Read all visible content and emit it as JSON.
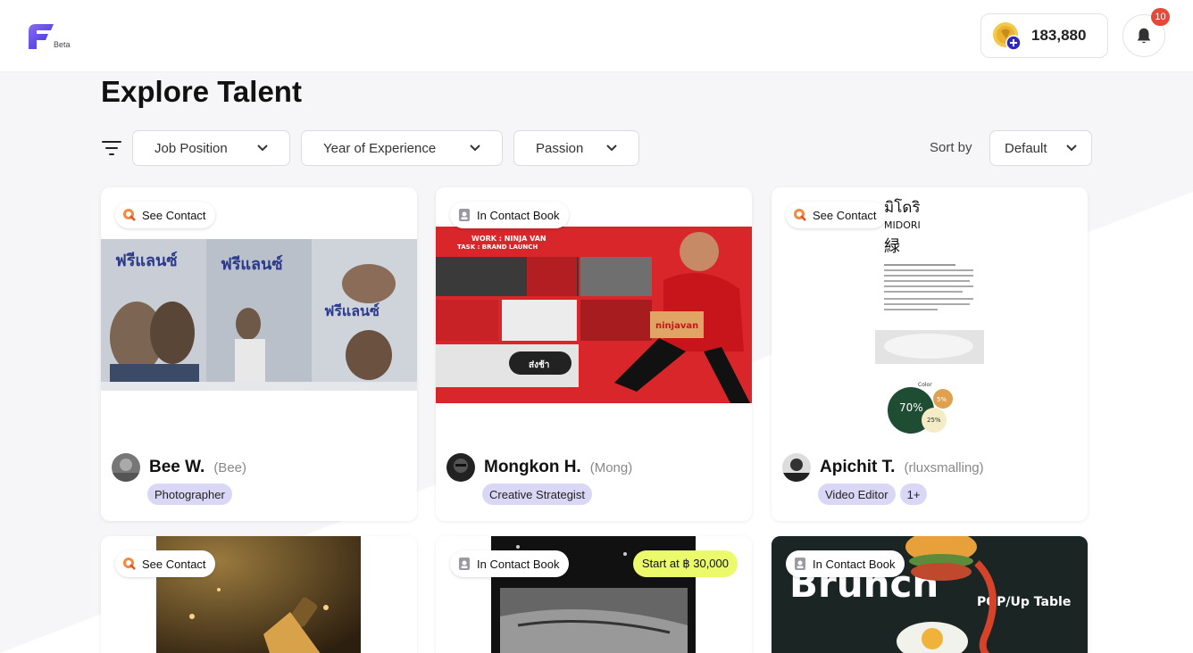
{
  "header": {
    "logo_label": "Beta",
    "coins": "183,880",
    "notification_count": "10"
  },
  "page": {
    "title": "Explore Talent"
  },
  "filters": {
    "job_position": "Job Position",
    "experience": "Year of Experience",
    "passion": "Passion",
    "sort_label": "Sort by",
    "sort_value": "Default"
  },
  "cards": [
    {
      "status": "See Contact",
      "name": "Bee W.",
      "nickname": "(Bee)",
      "tags": [
        "Photographer"
      ],
      "thumb_texts": [
        "ฟรีแลนซ์",
        "ฟรีแลนซ์",
        "ฟรีแลนซ์"
      ]
    },
    {
      "status": "In Contact Book",
      "name": "Mongkon H.",
      "nickname": "(Mong)",
      "tags": [
        "Creative Strategist"
      ],
      "thumb_texts": [
        "WORK : NINJA VAN",
        "TASK : BRAND LAUNCH",
        "ninjavan",
        "ส่งช้า"
      ]
    },
    {
      "status": "See Contact",
      "name": "Apichit T.",
      "nickname": "(rluxsmalling)",
      "tags": [
        "Video Editor",
        "1+"
      ],
      "thumb_texts": [
        "มิโดริ",
        "MIDORI",
        "緑",
        "Color",
        "70%",
        "5%",
        "25%"
      ]
    },
    {
      "status": "See Contact"
    },
    {
      "status": "In Contact Book",
      "price": "Start at ฿ 30,000"
    },
    {
      "status": "In Contact Book",
      "thumb_texts": [
        "Brunch",
        "POP/Up Table"
      ]
    }
  ],
  "colors": {
    "accent": "#5b4ef2",
    "tag_bg": "#dad6f5",
    "price_bg": "#eafa6a",
    "badge": "#e5493a",
    "ninjavan_red": "#d8262b"
  }
}
